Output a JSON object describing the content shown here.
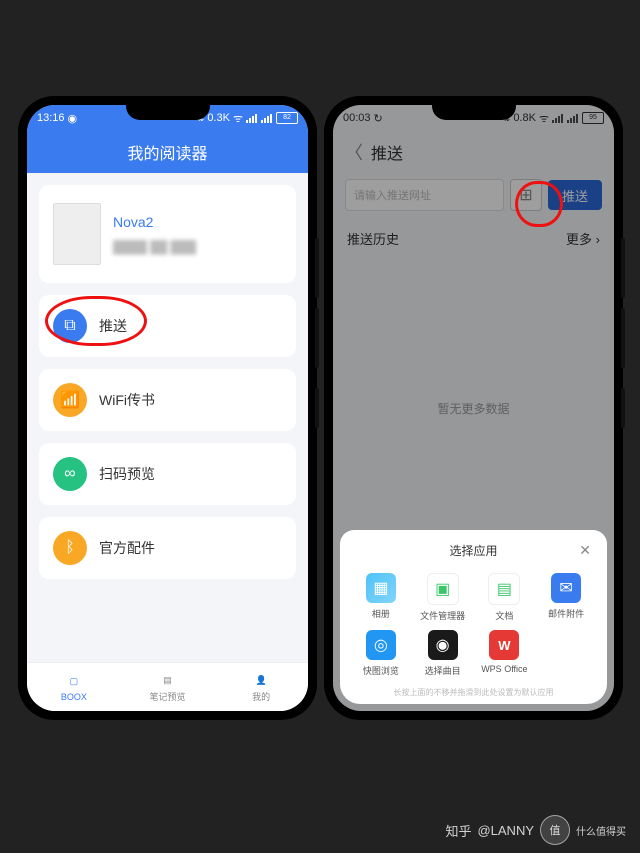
{
  "left": {
    "status": {
      "time": "13:16",
      "net": "0.3K",
      "battery": "82"
    },
    "header_title": "我的阅读器",
    "device": {
      "name": "Nova2",
      "id_masked": "████ ██ ███"
    },
    "menu": [
      {
        "key": "push",
        "label": "推送",
        "icon": "screens-icon",
        "color": "c-blue"
      },
      {
        "key": "wifi",
        "label": "WiFi传书",
        "icon": "wifi-doc-icon",
        "color": "c-orange"
      },
      {
        "key": "scan",
        "label": "扫码预览",
        "icon": "share-icon",
        "color": "c-green"
      },
      {
        "key": "acc",
        "label": "官方配件",
        "icon": "bluetooth-icon",
        "color": "c-amber"
      }
    ],
    "bottomnav": [
      {
        "label": "BOOX",
        "active": true
      },
      {
        "label": "笔记预览"
      },
      {
        "label": "我的"
      }
    ]
  },
  "right": {
    "status": {
      "time": "00:03",
      "net": "0.8K",
      "battery": "95"
    },
    "header_title": "推送",
    "input_placeholder": "请输入推送网址",
    "push_button": "推送",
    "history_label": "推送历史",
    "more_label": "更多",
    "empty_text": "暂无更多数据",
    "sheet_title": "选择应用",
    "sheet_hint": "长按上面的不移并拖滑到此处设置为默认应用",
    "apps": [
      {
        "label": "相册",
        "cls": "ico1",
        "glyph": "▦"
      },
      {
        "label": "文件管理器",
        "cls": "ico2",
        "glyph": "▣"
      },
      {
        "label": "文档",
        "cls": "ico3",
        "glyph": "▤"
      },
      {
        "label": "邮件附件",
        "cls": "ico4",
        "glyph": "✉"
      },
      {
        "label": "快图浏览",
        "cls": "ico5",
        "glyph": "◎"
      },
      {
        "label": "选择曲目",
        "cls": "ico6",
        "glyph": "◉"
      },
      {
        "label": "WPS Office",
        "cls": "ico7",
        "glyph": "W"
      }
    ]
  },
  "watermark": {
    "site": "知乎",
    "author": "@LANNY",
    "badge": "值",
    "tag": "什么值得买"
  },
  "colors": {
    "accent": "#3a7bf0",
    "ring": "#e11"
  }
}
